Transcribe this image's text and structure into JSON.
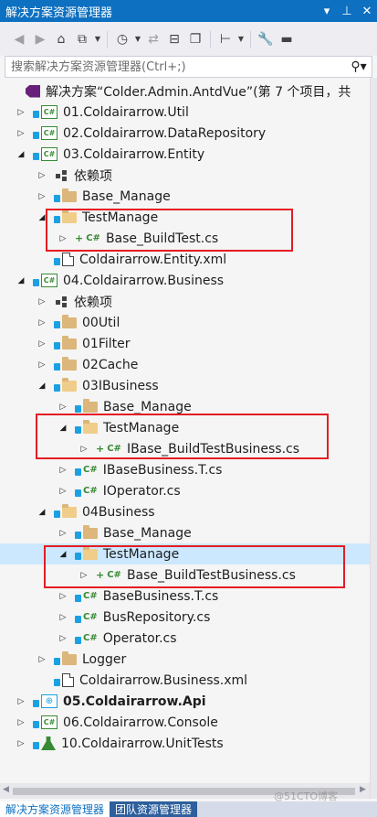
{
  "panel": {
    "title": "解决方案资源管理器",
    "title_buttons": [
      "▾",
      "⊥",
      "✕"
    ]
  },
  "search": {
    "placeholder": "搜索解决方案资源管理器(Ctrl+;)"
  },
  "tree": [
    {
      "label": "解决方案“Colder.Admin.AntdVue”(第 7 个项目，共",
      "icon": "solution",
      "expander": "none",
      "depth": 0
    },
    {
      "label": "01.Coldairarrow.Util",
      "icon": "csproj",
      "expander": "collapsed",
      "depth": 0
    },
    {
      "label": "02.Coldairarrow.DataRepository",
      "icon": "csproj",
      "expander": "collapsed",
      "depth": 0
    },
    {
      "label": "03.Coldairarrow.Entity",
      "icon": "csproj",
      "expander": "expanded",
      "depth": 0
    },
    {
      "label": "依赖项",
      "icon": "dependencies",
      "expander": "collapsed",
      "depth": 1
    },
    {
      "label": "Base_Manage",
      "icon": "folder",
      "expander": "collapsed",
      "depth": 1
    },
    {
      "label": "TestManage",
      "icon": "folder-open",
      "expander": "expanded",
      "depth": 1
    },
    {
      "label": "Base_BuildTest.cs",
      "icon": "csfile-new",
      "expander": "collapsed",
      "depth": 2
    },
    {
      "label": "Coldairarrow.Entity.xml",
      "icon": "xml",
      "expander": "none",
      "depth": 1
    },
    {
      "label": "04.Coldairarrow.Business",
      "icon": "csproj",
      "expander": "expanded",
      "depth": 0
    },
    {
      "label": "依赖项",
      "icon": "dependencies",
      "expander": "collapsed",
      "depth": 1
    },
    {
      "label": "00Util",
      "icon": "folder",
      "expander": "collapsed",
      "depth": 1
    },
    {
      "label": "01Filter",
      "icon": "folder",
      "expander": "collapsed",
      "depth": 1
    },
    {
      "label": "02Cache",
      "icon": "folder",
      "expander": "collapsed",
      "depth": 1
    },
    {
      "label": "03IBusiness",
      "icon": "folder-open",
      "expander": "expanded",
      "depth": 1
    },
    {
      "label": "Base_Manage",
      "icon": "folder",
      "expander": "collapsed",
      "depth": 2
    },
    {
      "label": "TestManage",
      "icon": "folder-open",
      "expander": "expanded",
      "depth": 2
    },
    {
      "label": "IBase_BuildTestBusiness.cs",
      "icon": "csfile-new",
      "expander": "collapsed",
      "depth": 3
    },
    {
      "label": "IBaseBusiness.T.cs",
      "icon": "csfile",
      "expander": "collapsed",
      "depth": 2
    },
    {
      "label": "IOperator.cs",
      "icon": "csfile",
      "expander": "collapsed",
      "depth": 2
    },
    {
      "label": "04Business",
      "icon": "folder-open",
      "expander": "expanded",
      "depth": 1
    },
    {
      "label": "Base_Manage",
      "icon": "folder",
      "expander": "collapsed",
      "depth": 2
    },
    {
      "label": "TestManage",
      "icon": "folder-open",
      "expander": "expanded",
      "depth": 2,
      "selected": true
    },
    {
      "label": "Base_BuildTestBusiness.cs",
      "icon": "csfile-new",
      "expander": "collapsed",
      "depth": 3
    },
    {
      "label": "BaseBusiness.T.cs",
      "icon": "csfile",
      "expander": "collapsed",
      "depth": 2
    },
    {
      "label": "BusRepository.cs",
      "icon": "csfile",
      "expander": "collapsed",
      "depth": 2
    },
    {
      "label": "Operator.cs",
      "icon": "csfile",
      "expander": "collapsed",
      "depth": 2
    },
    {
      "label": "Logger",
      "icon": "folder",
      "expander": "collapsed",
      "depth": 1
    },
    {
      "label": "Coldairarrow.Business.xml",
      "icon": "xml",
      "expander": "none",
      "depth": 1
    },
    {
      "label": "05.Coldairarrow.Api",
      "icon": "webproj",
      "expander": "collapsed",
      "depth": 0,
      "bold": true
    },
    {
      "label": "06.Coldairarrow.Console",
      "icon": "csproj",
      "expander": "collapsed",
      "depth": 0
    },
    {
      "label": "10.Coldairarrow.UnitTests",
      "icon": "testproj",
      "expander": "collapsed",
      "depth": 0
    }
  ],
  "tabs": [
    {
      "label": "解决方案资源管理器",
      "active": true
    },
    {
      "label": "团队资源管理器",
      "active": false
    }
  ],
  "watermark": "@51CTO博客",
  "colors": {
    "accent": "#0e70c0",
    "selection": "#cce8ff",
    "highlight_box": "#e41c25",
    "cs_green": "#388a34"
  }
}
